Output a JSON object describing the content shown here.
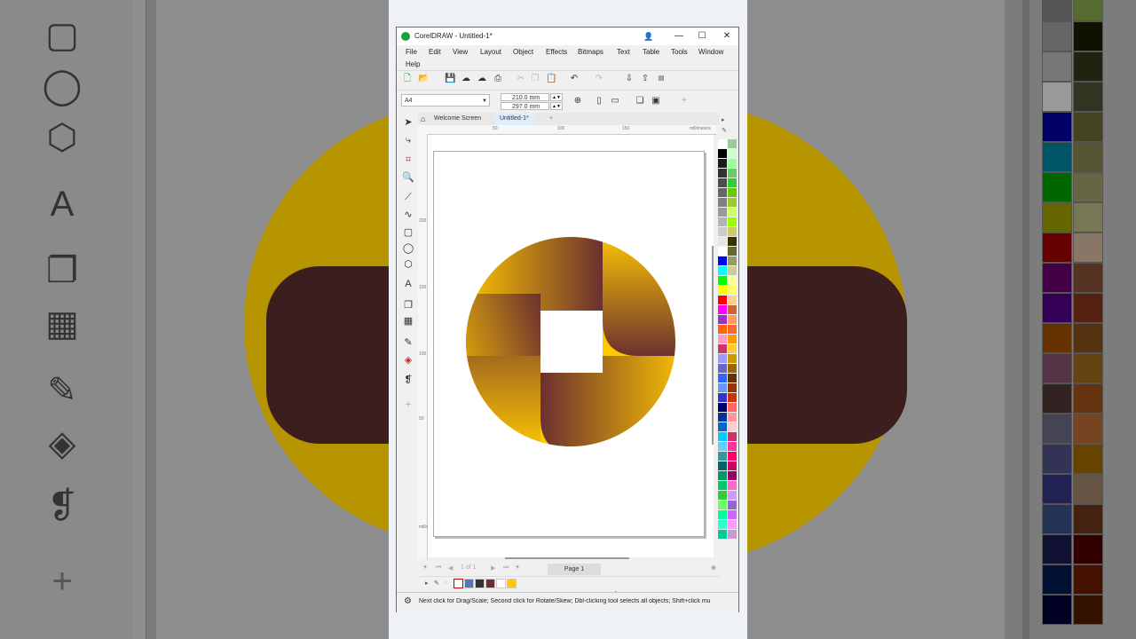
{
  "window": {
    "title": "CorelDRAW - Untitled-1*",
    "controls": {
      "minimize": "—",
      "maximize": "☐",
      "close": "✕"
    }
  },
  "menu": [
    "File",
    "Edit",
    "View",
    "Layout",
    "Object",
    "Effects",
    "Bitmaps",
    "Text",
    "Table",
    "Tools",
    "Window",
    "Help"
  ],
  "property_bar": {
    "page_size": "A4",
    "width": "210.0 mm",
    "height": "297.0 mm"
  },
  "tabs": {
    "welcome": "Welcome Screen",
    "document": "Untitled-1*",
    "add": "+"
  },
  "rulers": {
    "h": [
      "50",
      "100",
      "150",
      "millimeters"
    ],
    "v": [
      "200",
      "150",
      "100",
      "50",
      "millimeters"
    ]
  },
  "page_nav": {
    "counter": "1 of 1",
    "page_tab": "Page 1"
  },
  "status_text": "Next click for Drag/Scale; Second click for Rotate/Skew; Dbl-clicking tool selects all objects; Shift+click mu",
  "colors": {
    "gold": "#ffc800",
    "brown": "#6b3030",
    "accent": "#1aa33c"
  },
  "palette_left": [
    "#ffffff",
    "#000000",
    "#1a1a1a",
    "#333333",
    "#4d4d4d",
    "#666666",
    "#808080",
    "#999999",
    "#b3b3b3",
    "#cccccc",
    "#e6e6e6",
    "#ffffff",
    "#0000ff",
    "#00ffff",
    "#00ff00",
    "#ffff00",
    "#ff0000",
    "#ff00ff",
    "#9933cc",
    "#ff6600",
    "#ff99cc",
    "#cc3366",
    "#9999ff",
    "#6666cc",
    "#3366ff",
    "#6699ff",
    "#3333cc",
    "#000066",
    "#003399",
    "#0066cc",
    "#00ccff",
    "#66ccff",
    "#339999",
    "#006666",
    "#009966",
    "#00cc66",
    "#33cc33",
    "#66ff66",
    "#00ff99",
    "#33ffcc",
    "#00cc99"
  ],
  "palette_right": [
    "#99cc99",
    "#ccffcc",
    "#99ff99",
    "#66cc66",
    "#33cc33",
    "#66cc00",
    "#99cc33",
    "#ccff66",
    "#99ff00",
    "#cccc66",
    "#333300",
    "#666633",
    "#999966",
    "#cccc99",
    "#ffff99",
    "#ffff66",
    "#ffcc99",
    "#cc6633",
    "#ff9966",
    "#ff6633",
    "#ff9900",
    "#ffcc33",
    "#cc9900",
    "#996600",
    "#663300",
    "#993300",
    "#cc3300",
    "#ff6666",
    "#ff9999",
    "#ffcccc",
    "#cc3366",
    "#ff3399",
    "#ff0066",
    "#cc0066",
    "#990066",
    "#ff66cc",
    "#cc99ff",
    "#9966cc",
    "#cc66ff",
    "#ff99ff",
    "#cc99cc"
  ],
  "document_palette": [
    "#5577aa",
    "#333333",
    "#6b3030",
    "#ffffff",
    "#ffc800"
  ],
  "icons": [
    "pick-icon",
    "shape-icon",
    "crop-icon",
    "zoom-icon",
    "freehand-icon",
    "artistic-media-icon",
    "rectangle-icon",
    "ellipse-icon",
    "polygon-icon",
    "text-icon",
    "shadow-icon",
    "transparency-icon",
    "eyedropper-icon",
    "fill-icon",
    "smart-fill-icon",
    "add-tool-icon"
  ]
}
